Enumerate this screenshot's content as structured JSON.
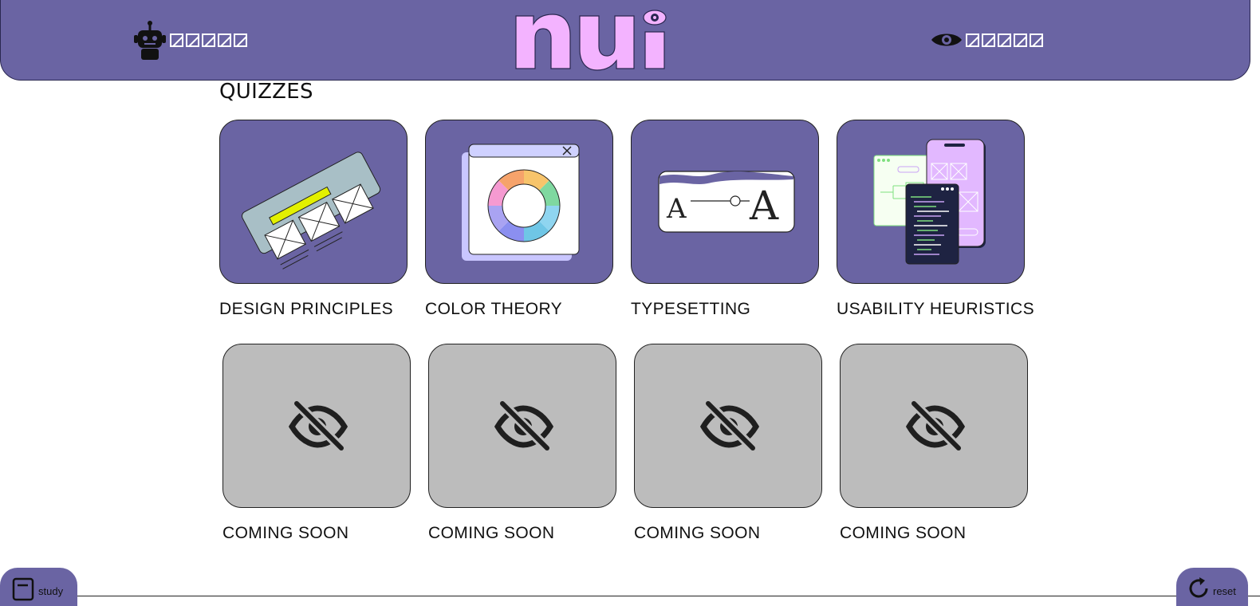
{
  "header": {
    "logo_text": "nui",
    "ai_stat": {
      "icon": "robot-icon",
      "value_glyphs": 5
    },
    "human_stat": {
      "icon": "eye-icon",
      "value_glyphs": 5
    }
  },
  "section": {
    "title": "QUIZZES"
  },
  "quizzes": [
    {
      "label": "DESIGN PRINCIPLES",
      "icon": "wireframe-illustration"
    },
    {
      "label": "COLOR THEORY",
      "icon": "color-wheel-illustration"
    },
    {
      "label": "TYPESETTING",
      "icon": "type-scale-slider-illustration"
    },
    {
      "label": "USABILITY HEURISTICS",
      "icon": "app-screens-illustration"
    }
  ],
  "locked": [
    {
      "label": "COMING SOON",
      "icon": "eye-off-icon"
    },
    {
      "label": "COMING SOON",
      "icon": "eye-off-icon"
    },
    {
      "label": "COMING SOON",
      "icon": "eye-off-icon"
    },
    {
      "label": "COMING SOON",
      "icon": "eye-off-icon"
    }
  ],
  "footer": {
    "study_label": "study",
    "reset_label": "reset"
  },
  "colors": {
    "brand_purple": "#6a64a3",
    "logo_pink": "#f3b3ff",
    "locked_gray": "#bcbcbc"
  }
}
